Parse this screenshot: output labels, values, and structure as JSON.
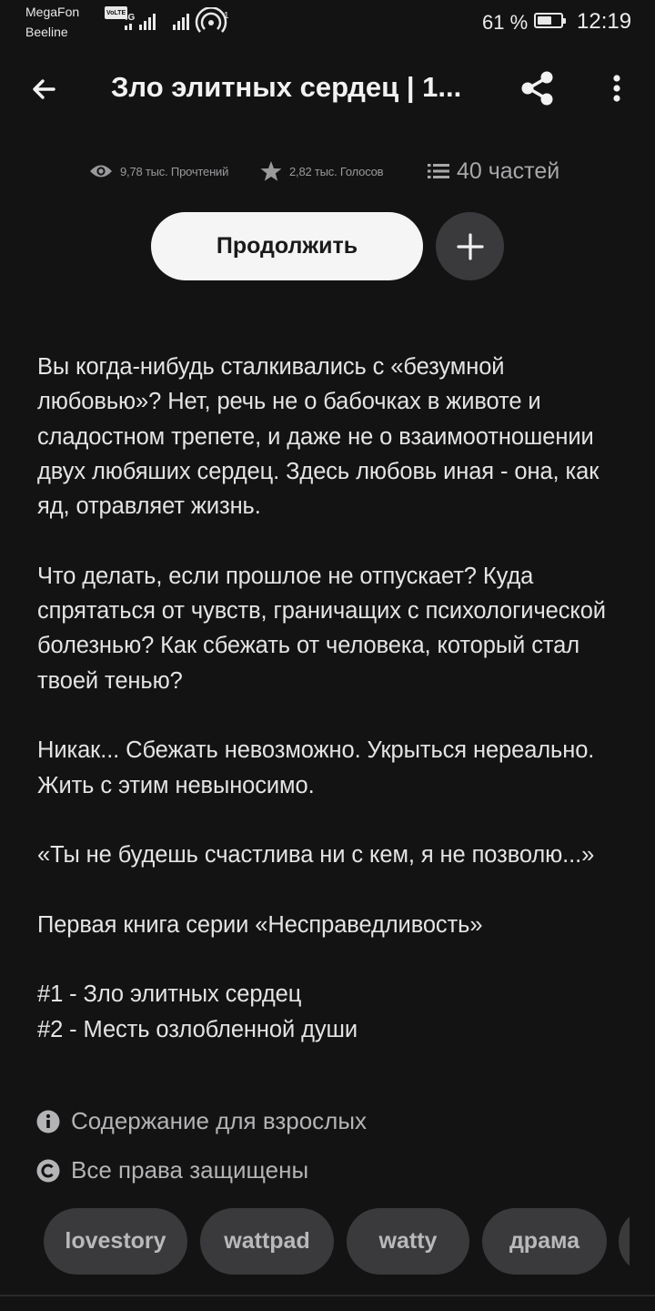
{
  "status_bar": {
    "carrier_1": "MegaFon",
    "carrier_2": "Beeline",
    "volte_label": "VoLTE",
    "network_label": "4G",
    "hotspot_count": "1",
    "battery_percent": "61 %",
    "battery_level": 0.61,
    "time": "12:19"
  },
  "header": {
    "title": "Зло элитных сердец | 1..."
  },
  "stats": {
    "reads": "9,78 тыс. Прочтений",
    "votes": "2,82 тыс. Голосов",
    "parts": "40 частей"
  },
  "actions": {
    "continue_label": "Продолжить"
  },
  "description": {
    "paragraphs": [
      "Вы когда-нибудь сталкивались с «безумной любовью»? Нет, речь не о бабочках в животе и сладостном трепете, и даже не о взаимоотношении двух любяших сердец. Здесь любовь иная - она, как яд, отравляет жизнь.",
      "Что делать, если прошлое не отпускает? Куда спрятаться от чувств, граничащих с психологической болезнью? Как сбежать от человека, который стал твоей тенью?",
      "Никак... Сбежать невозможно. Укрыться нереально. Жить с этим невыносимо.",
      "«Ты не будешь счастлива ни с кем, я не позволю...»",
      "Первая книга серии «Несправедливость»",
      "#1 - Зло элитных сердец\n#2 - Месть озлобленной души"
    ]
  },
  "meta": {
    "mature": "Содержание для взрослых",
    "copyright": "Все права защищены"
  },
  "tags": [
    "lovestory",
    "wattpad",
    "watty",
    "драма"
  ]
}
